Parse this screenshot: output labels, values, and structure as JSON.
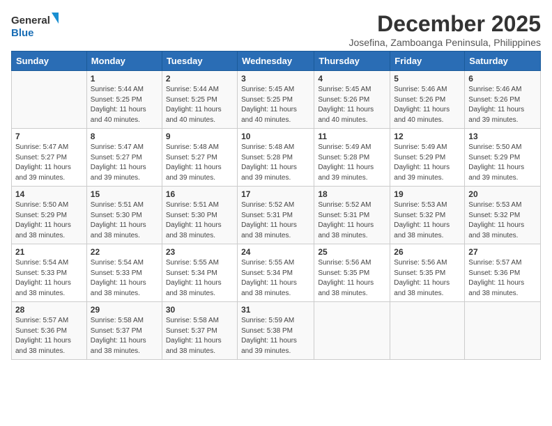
{
  "logo": {
    "line1": "General",
    "line2": "Blue"
  },
  "title": "December 2025",
  "location": "Josefina, Zamboanga Peninsula, Philippines",
  "days_header": [
    "Sunday",
    "Monday",
    "Tuesday",
    "Wednesday",
    "Thursday",
    "Friday",
    "Saturday"
  ],
  "weeks": [
    [
      {
        "day": "",
        "info": ""
      },
      {
        "day": "1",
        "info": "Sunrise: 5:44 AM\nSunset: 5:25 PM\nDaylight: 11 hours\nand 40 minutes."
      },
      {
        "day": "2",
        "info": "Sunrise: 5:44 AM\nSunset: 5:25 PM\nDaylight: 11 hours\nand 40 minutes."
      },
      {
        "day": "3",
        "info": "Sunrise: 5:45 AM\nSunset: 5:25 PM\nDaylight: 11 hours\nand 40 minutes."
      },
      {
        "day": "4",
        "info": "Sunrise: 5:45 AM\nSunset: 5:26 PM\nDaylight: 11 hours\nand 40 minutes."
      },
      {
        "day": "5",
        "info": "Sunrise: 5:46 AM\nSunset: 5:26 PM\nDaylight: 11 hours\nand 40 minutes."
      },
      {
        "day": "6",
        "info": "Sunrise: 5:46 AM\nSunset: 5:26 PM\nDaylight: 11 hours\nand 39 minutes."
      }
    ],
    [
      {
        "day": "7",
        "info": "Sunrise: 5:47 AM\nSunset: 5:27 PM\nDaylight: 11 hours\nand 39 minutes."
      },
      {
        "day": "8",
        "info": "Sunrise: 5:47 AM\nSunset: 5:27 PM\nDaylight: 11 hours\nand 39 minutes."
      },
      {
        "day": "9",
        "info": "Sunrise: 5:48 AM\nSunset: 5:27 PM\nDaylight: 11 hours\nand 39 minutes."
      },
      {
        "day": "10",
        "info": "Sunrise: 5:48 AM\nSunset: 5:28 PM\nDaylight: 11 hours\nand 39 minutes."
      },
      {
        "day": "11",
        "info": "Sunrise: 5:49 AM\nSunset: 5:28 PM\nDaylight: 11 hours\nand 39 minutes."
      },
      {
        "day": "12",
        "info": "Sunrise: 5:49 AM\nSunset: 5:29 PM\nDaylight: 11 hours\nand 39 minutes."
      },
      {
        "day": "13",
        "info": "Sunrise: 5:50 AM\nSunset: 5:29 PM\nDaylight: 11 hours\nand 39 minutes."
      }
    ],
    [
      {
        "day": "14",
        "info": "Sunrise: 5:50 AM\nSunset: 5:29 PM\nDaylight: 11 hours\nand 38 minutes."
      },
      {
        "day": "15",
        "info": "Sunrise: 5:51 AM\nSunset: 5:30 PM\nDaylight: 11 hours\nand 38 minutes."
      },
      {
        "day": "16",
        "info": "Sunrise: 5:51 AM\nSunset: 5:30 PM\nDaylight: 11 hours\nand 38 minutes."
      },
      {
        "day": "17",
        "info": "Sunrise: 5:52 AM\nSunset: 5:31 PM\nDaylight: 11 hours\nand 38 minutes."
      },
      {
        "day": "18",
        "info": "Sunrise: 5:52 AM\nSunset: 5:31 PM\nDaylight: 11 hours\nand 38 minutes."
      },
      {
        "day": "19",
        "info": "Sunrise: 5:53 AM\nSunset: 5:32 PM\nDaylight: 11 hours\nand 38 minutes."
      },
      {
        "day": "20",
        "info": "Sunrise: 5:53 AM\nSunset: 5:32 PM\nDaylight: 11 hours\nand 38 minutes."
      }
    ],
    [
      {
        "day": "21",
        "info": "Sunrise: 5:54 AM\nSunset: 5:33 PM\nDaylight: 11 hours\nand 38 minutes."
      },
      {
        "day": "22",
        "info": "Sunrise: 5:54 AM\nSunset: 5:33 PM\nDaylight: 11 hours\nand 38 minutes."
      },
      {
        "day": "23",
        "info": "Sunrise: 5:55 AM\nSunset: 5:34 PM\nDaylight: 11 hours\nand 38 minutes."
      },
      {
        "day": "24",
        "info": "Sunrise: 5:55 AM\nSunset: 5:34 PM\nDaylight: 11 hours\nand 38 minutes."
      },
      {
        "day": "25",
        "info": "Sunrise: 5:56 AM\nSunset: 5:35 PM\nDaylight: 11 hours\nand 38 minutes."
      },
      {
        "day": "26",
        "info": "Sunrise: 5:56 AM\nSunset: 5:35 PM\nDaylight: 11 hours\nand 38 minutes."
      },
      {
        "day": "27",
        "info": "Sunrise: 5:57 AM\nSunset: 5:36 PM\nDaylight: 11 hours\nand 38 minutes."
      }
    ],
    [
      {
        "day": "28",
        "info": "Sunrise: 5:57 AM\nSunset: 5:36 PM\nDaylight: 11 hours\nand 38 minutes."
      },
      {
        "day": "29",
        "info": "Sunrise: 5:58 AM\nSunset: 5:37 PM\nDaylight: 11 hours\nand 38 minutes."
      },
      {
        "day": "30",
        "info": "Sunrise: 5:58 AM\nSunset: 5:37 PM\nDaylight: 11 hours\nand 38 minutes."
      },
      {
        "day": "31",
        "info": "Sunrise: 5:59 AM\nSunset: 5:38 PM\nDaylight: 11 hours\nand 39 minutes."
      },
      {
        "day": "",
        "info": ""
      },
      {
        "day": "",
        "info": ""
      },
      {
        "day": "",
        "info": ""
      }
    ]
  ]
}
